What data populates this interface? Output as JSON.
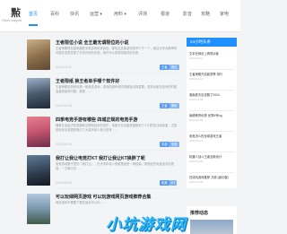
{
  "logo": {
    "mark": "㸃",
    "sub": "iTech.kaiyun"
  },
  "nav": [
    "首页",
    "百科",
    "快讯",
    "运营 ▾",
    "用料 ▾",
    "评测",
    "报道",
    "影音",
    "攻略",
    "家电",
    "更多"
  ],
  "posts": [
    {
      "title": "王者限位小说 全王最无谓限位的小说",
      "desc": "王者荣耀现在越来越受手机游戏玩家喜欢，那玩过这款游戏的不少于一个，我估计你大概率有可能在这里发现了许多好玩的东西，我们可以把游戏相关的东西……",
      "date": "2023-04-11",
      "tags": [
        "王者",
        "限位"
      ]
    },
    {
      "title": "王者限纸 换王者单手哪个软件好",
      "desc": "王者荣耀说到底也是一款竞技游戏，游戏的操作和手感都相当的重要。很多玩家在游戏的时候会遇到各种问题，像是……",
      "date": "2023-04-08",
      "tags": [
        "王者",
        "限纸"
      ]
    },
    {
      "title": "四季电竞手游有哪些 四城正规的电竞手游",
      "desc": "随着社会经济的发展和互联网技术的进步，电竞行业也越来越受到了人们的关注和喜爱，尤其是电竞手游更是吸引了大量年轻人参与进来……",
      "date": "2023-04-06",
      "tags": [
        "手游",
        "电竞"
      ]
    },
    {
      "title": "我打让我让电竞打KT 我打让我让KT换胖了呢",
      "desc": "电竞游戏圈子里的「我打让」，在许多年轻人的眼里就是一场较量。想想这些电竞选手的表现，一方面讨论……",
      "date": "2023-04-05",
      "tags": [
        "电竞",
        "KT"
      ]
    },
    {
      "title": "可以玩绿网页游戏 可以玩游戏网页游戏推荐合集",
      "desc": "网页游戏不需要下载安装也可以玩……",
      "date": "2023-04-03",
      "tags": []
    }
  ],
  "sidebar": {
    "head": "24小时头条",
    "items": [
      {
        "title": "文本在网页上再现对象",
        "date": "2023-04-11"
      },
      {
        "title": "王者荣耀开启新赛季 排行",
        "date": "2023-04-10"
      },
      {
        "title": "迦南夏天应说服了2024",
        "date": "2023-04-09"
      },
      {
        "title": "缘峰教育优势 优秀6号lvg",
        "date": "2023-04-08"
      },
      {
        "title": "电竞怎么的全球游戏王者",
        "date": "2023-04-07"
      },
      {
        "title": "机器人战斗王者全新设计",
        "date": "2023-04-06"
      },
      {
        "title": "在线玩游戏推荐 方便 (最长服)",
        "date": "2023-04-05"
      }
    ],
    "card2_title": "推荐动态"
  },
  "watermark": "小坑游戏网"
}
